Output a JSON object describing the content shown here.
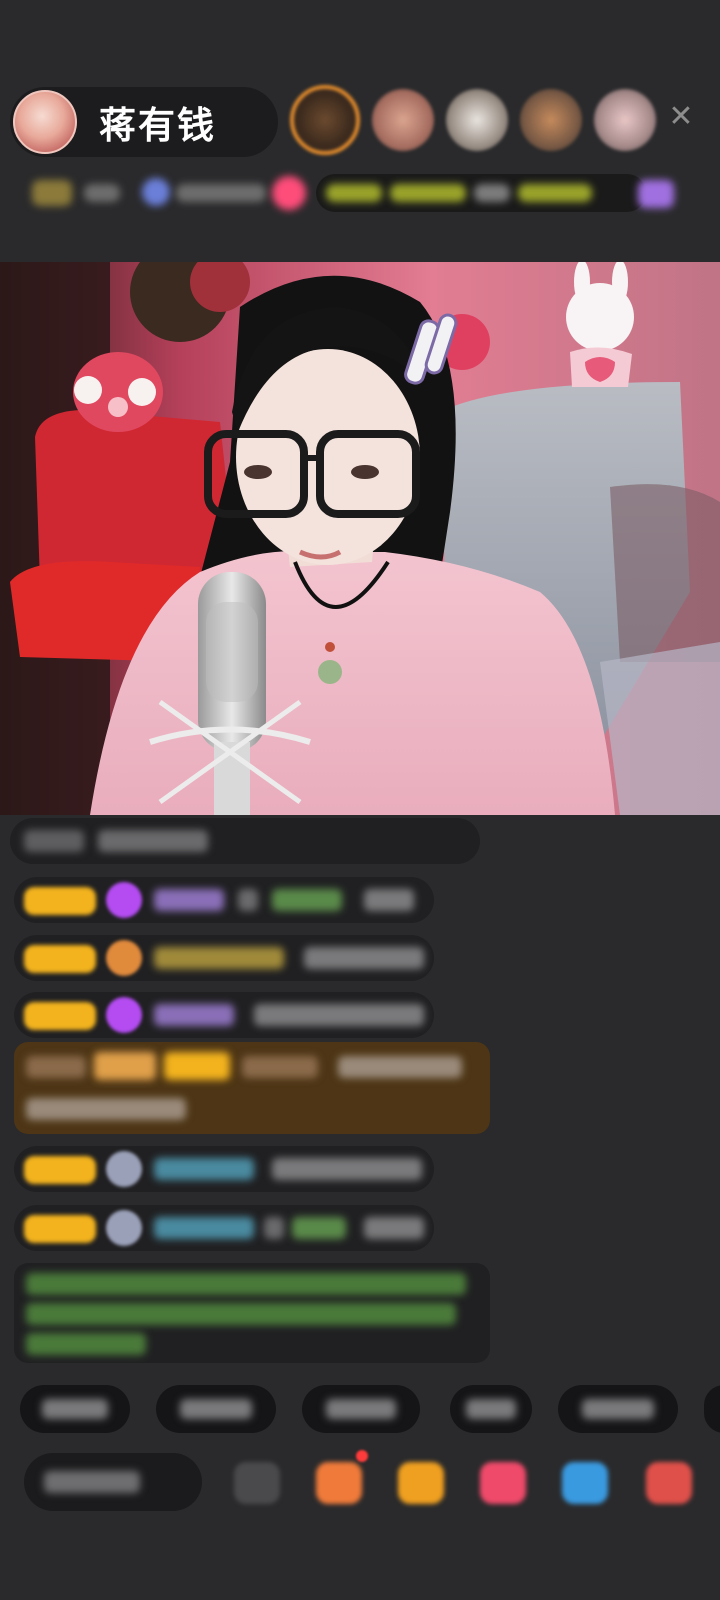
{
  "header": {
    "host_name": "蒋有钱",
    "close_icon": "close-icon"
  },
  "colors": {
    "background": "#2a2a2c",
    "pill": "#1c1c1e",
    "badge_gold": "#f3b31e",
    "gift_highlight": "#5a3a12",
    "green_text": "#7fbf6a",
    "teal_name": "#5ab4c8"
  }
}
